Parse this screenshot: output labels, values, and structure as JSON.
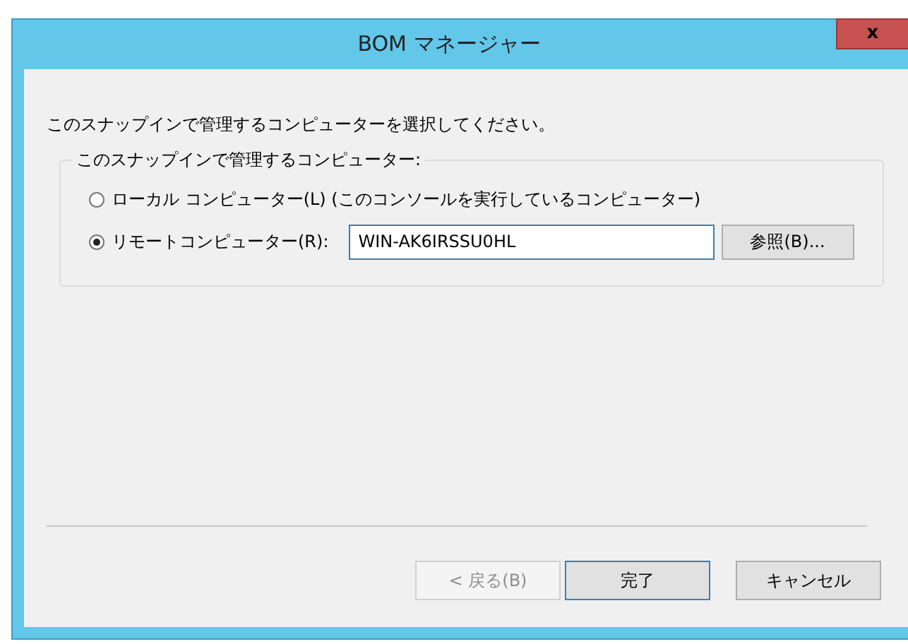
{
  "window": {
    "title": "BOM マネージャー",
    "close_label": "x"
  },
  "instruction": "このスナップインで管理するコンピューターを選択してください。",
  "group": {
    "legend": "このスナップインで管理するコンピューター:",
    "options": [
      {
        "label": "ローカル コンピューター(L) (このコンソールを実行しているコンピューター)",
        "selected": false
      },
      {
        "label": "リモートコンピューター(R):",
        "selected": true
      }
    ],
    "computer_name": {
      "value": "WIN-AK6IRSSU0HL"
    },
    "browse_button": "参照(B)..."
  },
  "buttons": [
    {
      "label": "< 戻る(B)",
      "disabled": true,
      "default": false
    },
    {
      "label": "完了",
      "disabled": false,
      "default": true
    },
    {
      "label": "キャンセル",
      "disabled": false,
      "default": false
    }
  ]
}
